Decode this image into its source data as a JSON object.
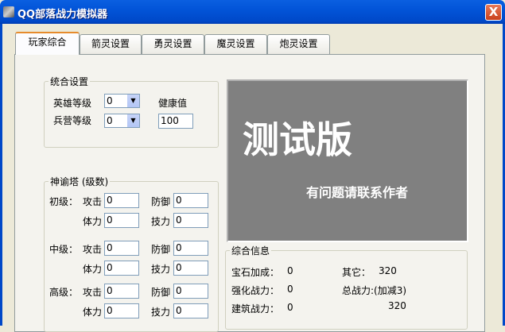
{
  "window": {
    "title": "QQ部落战力模拟器",
    "close": "X"
  },
  "tabs": [
    "玩家综合",
    "箭灵设置",
    "勇灵设置",
    "魔灵设置",
    "炮灵设置"
  ],
  "settings": {
    "legend": "统合设置",
    "hero_level_label": "英雄等级",
    "hero_level": "0",
    "barracks_level_label": "兵营等级",
    "barracks_level": "0",
    "health_label": "健康值",
    "health": "100"
  },
  "tower": {
    "legend": "神谕塔 (级数)",
    "attack": "攻击",
    "defense": "防御",
    "stamina": "体力",
    "skill": "技力",
    "rows": [
      {
        "label": "初级：",
        "attack": "0",
        "defense": "0",
        "stamina": "0",
        "skill": "0"
      },
      {
        "label": "中级：",
        "attack": "0",
        "defense": "0",
        "stamina": "0",
        "skill": "0"
      },
      {
        "label": "高级：",
        "attack": "0",
        "defense": "0",
        "stamina": "0",
        "skill": "0"
      }
    ]
  },
  "banner": {
    "title": "测试版",
    "subtitle": "有问题请联系作者"
  },
  "info": {
    "legend": "综合信息",
    "gem_label": "宝石加成：",
    "gem": "0",
    "enhance_label": "强化战力：",
    "enhance": "0",
    "building_label": "建筑战力：",
    "building": "0",
    "other_label": "其它：",
    "other": "320",
    "total_label": "总战力:(加减3)",
    "total": "320"
  }
}
